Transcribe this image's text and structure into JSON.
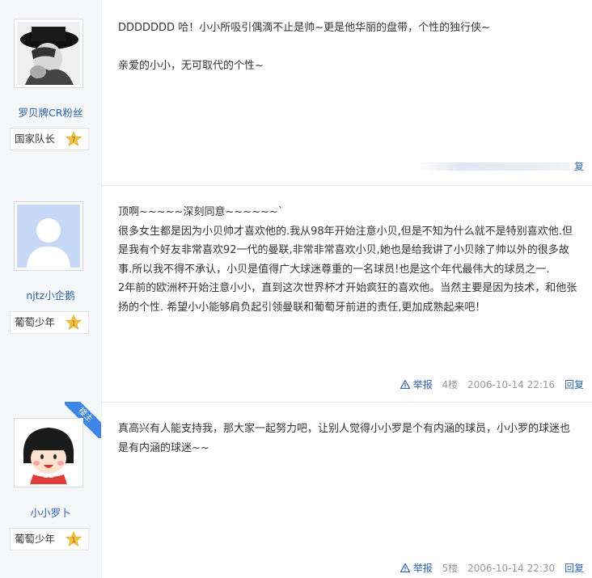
{
  "posts": [
    {
      "username": "罗贝牌CR粉丝",
      "level": "国家队长",
      "level_badge": "7",
      "paragraphs": [
        "DDDDDDD 哈！小小所吸引偶滴不止是帅~更是他华丽的盘带，个性的独行侠~",
        "",
        "亲爱的小小，无可取代的个性~"
      ],
      "reply": "复"
    },
    {
      "username": "njtz小企鹅",
      "level": "葡萄少年",
      "level_badge": "1",
      "paragraphs": [
        "顶啊~~~~~深刻同意~~~~~~`",
        "很多女生都是因为小贝帅才喜欢他的.我从98年开始注意小贝,但是不知为什么就不是特别喜欢他.但是我有个好友非常喜欢92一代的曼联,非常非常喜欢小贝,她也是给我讲了小贝除了帅以外的很多故事.所以我不得不承认，小贝是值得广大球迷尊重的一名球员!也是这个年代最伟大的球员之一.",
        "2年前的欧洲杯开始注意小小，直到这次世界杯才开始疯狂的喜欢他。当然主要是因为技术，和他张扬的个性. 希望小小能够肩负起引领曼联和葡萄牙前进的责任,更加成熟起来吧！"
      ],
      "report": "举报",
      "floor": "4楼",
      "time": "2006-10-14 22:16",
      "reply": "回复"
    },
    {
      "username": "小小罗卜",
      "level": "葡萄少年",
      "level_badge": "1",
      "ribbon": "楼主",
      "paragraphs": [
        "真高兴有人能支持我，那大家一起努力吧，让别人觉得小小罗是个有内涵的球员，小小罗的球迷也是有内涵的球迷~~"
      ],
      "report": "举报",
      "floor": "5楼",
      "time": "2006-10-14 22:30",
      "reply": "回复"
    }
  ],
  "colors": {
    "link": "#2d64b3",
    "sidebar_bg": "#f6f7f9",
    "ribbon": "#3d86e8",
    "star": "#f5c342"
  }
}
